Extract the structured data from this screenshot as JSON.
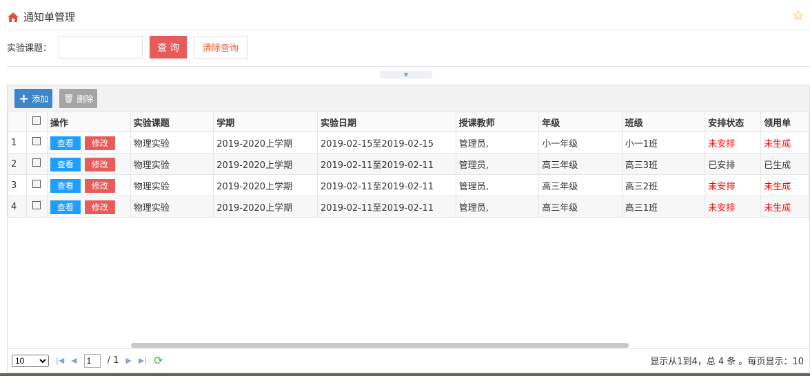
{
  "header": {
    "title": "通知单管理",
    "icon": "home-icon"
  },
  "search": {
    "label": "实验课题：",
    "value": "",
    "query_label": "查 询",
    "clear_label": "清除查询"
  },
  "toolbar": {
    "add_label": "添加",
    "delete_label": "删除"
  },
  "table": {
    "columns": [
      "操作",
      "实验课题",
      "学期",
      "实验日期",
      "授课教师",
      "年级",
      "班级",
      "安排状态",
      "领用单"
    ],
    "view_label": "查看",
    "edit_label": "修改",
    "rows": [
      {
        "n": "1",
        "subject": "物理实验",
        "term": "2019-2020上学期",
        "date": "2019-02-15至2019-02-15",
        "teacher": "管理员,",
        "grade": "小一年级",
        "cls": "小一1班",
        "status": "未安排",
        "form": "未生成"
      },
      {
        "n": "2",
        "subject": "物理实验",
        "term": "2019-2020上学期",
        "date": "2019-02-11至2019-02-11",
        "teacher": "管理员,",
        "grade": "高三年级",
        "cls": "高三3班",
        "status": "已安排",
        "form": "已生成"
      },
      {
        "n": "3",
        "subject": "物理实验",
        "term": "2019-2020上学期",
        "date": "2019-02-11至2019-02-11",
        "teacher": "管理员,",
        "grade": "高三年级",
        "cls": "高三2班",
        "status": "未安排",
        "form": "未生成"
      },
      {
        "n": "4",
        "subject": "物理实验",
        "term": "2019-2020上学期",
        "date": "2019-02-11至2019-02-11",
        "teacher": "管理员,",
        "grade": "高三年级",
        "cls": "高三1班",
        "status": "未安排",
        "form": "未生成"
      }
    ]
  },
  "pager": {
    "page_size": "10",
    "page": "1",
    "total_pages": "/ 1",
    "info": "显示从1到4，总 4 条 。每页显示：10"
  },
  "colors": {
    "red": "#e95b5b",
    "blue": "#1e9fff",
    "status_red": "#ff0000"
  }
}
